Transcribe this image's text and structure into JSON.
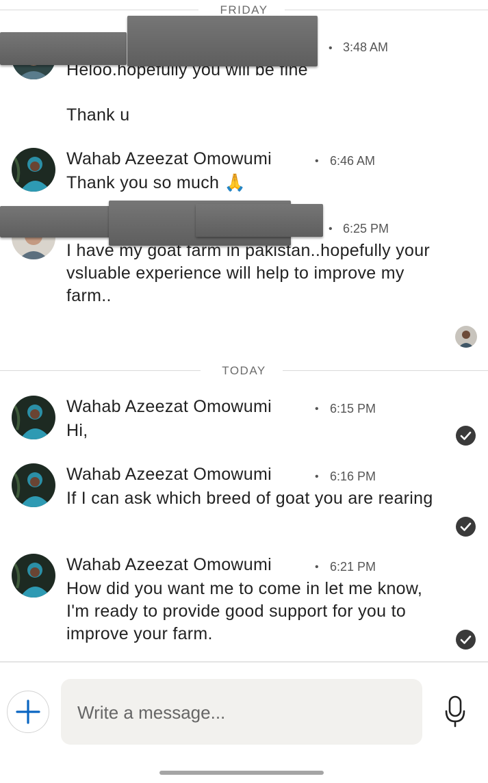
{
  "dividers": {
    "friday": "FRIDAY",
    "today": "TODAY"
  },
  "messages": [
    {
      "sender": "",
      "time": "3:48 AM",
      "text": "Heloo.hopefully you will be fine\n\nThank u"
    },
    {
      "sender": "Wahab Azeezat Omowumi",
      "time": "6:46 AM",
      "text": "Thank you so much 🙏"
    },
    {
      "sender": "",
      "time": "6:25 PM",
      "text": "I have my goat farm in pakistan..hopefully your vsluable experience will help to improve my farm.."
    },
    {
      "sender": "Wahab Azeezat Omowumi",
      "time": "6:15 PM",
      "text": "Hi,"
    },
    {
      "sender": "Wahab Azeezat Omowumi",
      "time": "6:16 PM",
      "text": "If I can ask which breed of goat you are rearing"
    },
    {
      "sender": "Wahab Azeezat Omowumi",
      "time": "6:21 PM",
      "text": "How did you want me to come in let me know, I'm ready to provide good support for you to improve your farm."
    }
  ],
  "separator": "•",
  "composer": {
    "placeholder": "Write a message..."
  },
  "icons": {
    "add": "plus-icon",
    "mic": "microphone-icon",
    "read_receipt": "check-circle-icon",
    "seen": "seen-avatar"
  },
  "colors": {
    "accent": "#0a66c2",
    "check": "#3a3a3a",
    "composer_bg": "#f2f1ee",
    "redaction": "#6a6a6a"
  }
}
